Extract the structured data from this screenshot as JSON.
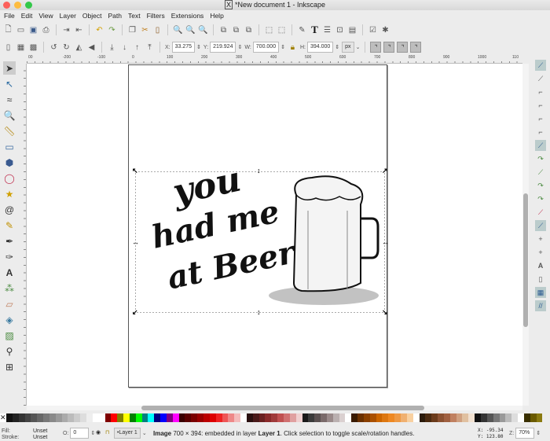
{
  "window": {
    "title": "*New document 1 - Inkscape"
  },
  "menu": [
    "File",
    "Edit",
    "View",
    "Layer",
    "Object",
    "Path",
    "Text",
    "Filters",
    "Extensions",
    "Help"
  ],
  "toolbar": {
    "x_label": "X:",
    "x": "33.275",
    "y_label": "Y:",
    "y": "219.924",
    "w_label": "W:",
    "w": "700.000",
    "h_label": "H:",
    "h": "394.000",
    "unit": "px"
  },
  "ruler": [
    "00",
    "-200",
    "-100",
    "0",
    "100",
    "200",
    "300",
    "400",
    "500",
    "600",
    "700",
    "800",
    "900",
    "1000",
    "110"
  ],
  "artwork": {
    "line1": "you",
    "line2": "had me",
    "line3": "at Beer"
  },
  "status": {
    "fill_label": "Fill:",
    "fill": "Unset",
    "stroke_label": "Stroke:",
    "stroke": "Unset",
    "opacity_label": "O:",
    "opacity": "0",
    "layer": "•Layer 1",
    "message_bold": "Image",
    "message": " 700 × 394: embedded in layer ",
    "layer_bold": "Layer 1",
    "message_end": ". Click selection to toggle scale/rotation handles.",
    "cx_label": "X:",
    "cx": "-95.34",
    "cy_label": "Y:",
    "cy": "123.80",
    "zoom_label": "Z:",
    "zoom": "70%"
  },
  "palette": [
    "#111",
    "#222",
    "#333",
    "#444",
    "#555",
    "#666",
    "#777",
    "#888",
    "#999",
    "#aaa",
    "#bbb",
    "#ccc",
    "#ddd",
    "#eee",
    "#fff",
    "#fff",
    "#800000",
    "#ff0000",
    "#808000",
    "#ffff00",
    "#008000",
    "#00ff00",
    "#008080",
    "#00ffff",
    "#000080",
    "#0000ff",
    "#800080",
    "#ff00ff",
    "#3a0000",
    "#5a0000",
    "#7a0000",
    "#990000",
    "#bb0000",
    "#dd0000",
    "#ee2222",
    "#ee5555",
    "#ee8888",
    "#f4bbbb",
    "#fff",
    "#2a1010",
    "#4a1a1a",
    "#6a2020",
    "#8a2a2a",
    "#a03a3a",
    "#c05050",
    "#d07070",
    "#e0a0a0",
    "#f0d0d0",
    "#1a1a1a",
    "#3a3a3a",
    "#5a5050",
    "#7a6a6a",
    "#9a8a8a",
    "#bab0b0",
    "#dad0d0",
    "#fff",
    "#3a1a00",
    "#6a3000",
    "#8a4000",
    "#aa5000",
    "#cc6600",
    "#dd7711",
    "#ee8822",
    "#ee9944",
    "#f0b070",
    "#f8d0a0",
    "#fff",
    "#2a1a0a",
    "#4a2a10",
    "#6a3a1a",
    "#8a5030",
    "#a06040",
    "#c08060",
    "#d0a080",
    "#e0c0a0",
    "#f0e0d0",
    "#111",
    "#333",
    "#555",
    "#777",
    "#999",
    "#bbb",
    "#ddd",
    "#fff",
    "#3a3000",
    "#6a5a00",
    "#8a7a10"
  ]
}
